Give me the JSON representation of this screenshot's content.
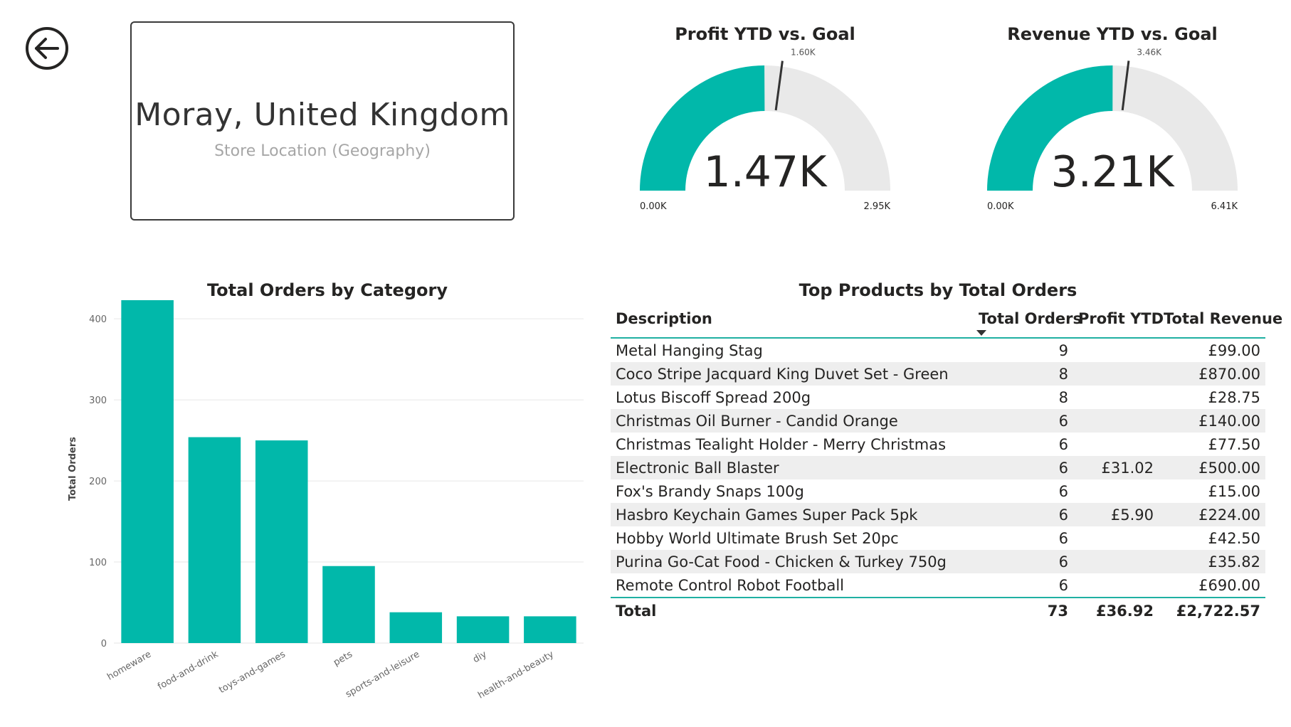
{
  "location_card": {
    "title": "Moray, United Kingdom",
    "subtitle": "Store Location (Geography)"
  },
  "gauges": [
    {
      "title": "Profit YTD vs. Goal",
      "value": 1470,
      "value_label": "1.47K",
      "min": 0,
      "min_label": "0.00K",
      "max": 2950,
      "max_label": "2.95K",
      "target": 1600,
      "target_label": "1.60K"
    },
    {
      "title": "Revenue YTD vs. Goal",
      "value": 3210,
      "value_label": "3.21K",
      "min": 0,
      "min_label": "0.00K",
      "max": 6410,
      "max_label": "6.41K",
      "target": 3460,
      "target_label": "3.46K"
    }
  ],
  "colors": {
    "accent": "#01b8aa",
    "track": "#e9e9e9",
    "text": "#252423",
    "grid": "#e6e6e6"
  },
  "chart_data": {
    "type": "bar",
    "title": "Total Orders by Category",
    "xlabel": "",
    "ylabel": "Total Orders",
    "categories": [
      "homeware",
      "food-and-drink",
      "toys-and-games",
      "pets",
      "sports-and-leisure",
      "diy",
      "health-and-beauty"
    ],
    "values": [
      423,
      254,
      250,
      95,
      38,
      33,
      33
    ],
    "ylim": [
      0,
      430
    ],
    "yticks": [
      0,
      100,
      200,
      300,
      400
    ],
    "grid": true
  },
  "table": {
    "title": "Top Products by Total Orders",
    "columns": [
      "Description",
      "Total Orders",
      "Profit YTD",
      "Total Revenue"
    ],
    "rows": [
      [
        "Metal Hanging Stag",
        "9",
        "",
        "£99.00"
      ],
      [
        "Coco Stripe Jacquard King Duvet Set - Green",
        "8",
        "",
        "£870.00"
      ],
      [
        "Lotus Biscoff Spread 200g",
        "8",
        "",
        "£28.75"
      ],
      [
        "Christmas Oil Burner - Candid Orange",
        "6",
        "",
        "£140.00"
      ],
      [
        "Christmas Tealight Holder - Merry Christmas",
        "6",
        "",
        "£77.50"
      ],
      [
        "Electronic Ball Blaster",
        "6",
        "£31.02",
        "£500.00"
      ],
      [
        "Fox's Brandy Snaps 100g",
        "6",
        "",
        "£15.00"
      ],
      [
        "Hasbro Keychain Games Super Pack 5pk",
        "6",
        "£5.90",
        "£224.00"
      ],
      [
        "Hobby World Ultimate Brush Set 20pc",
        "6",
        "",
        "£42.50"
      ],
      [
        "Purina Go-Cat Food - Chicken & Turkey 750g",
        "6",
        "",
        "£35.82"
      ],
      [
        "Remote Control Robot Football",
        "6",
        "",
        "£690.00"
      ]
    ],
    "total": [
      "Total",
      "73",
      "£36.92",
      "£2,722.57"
    ]
  }
}
